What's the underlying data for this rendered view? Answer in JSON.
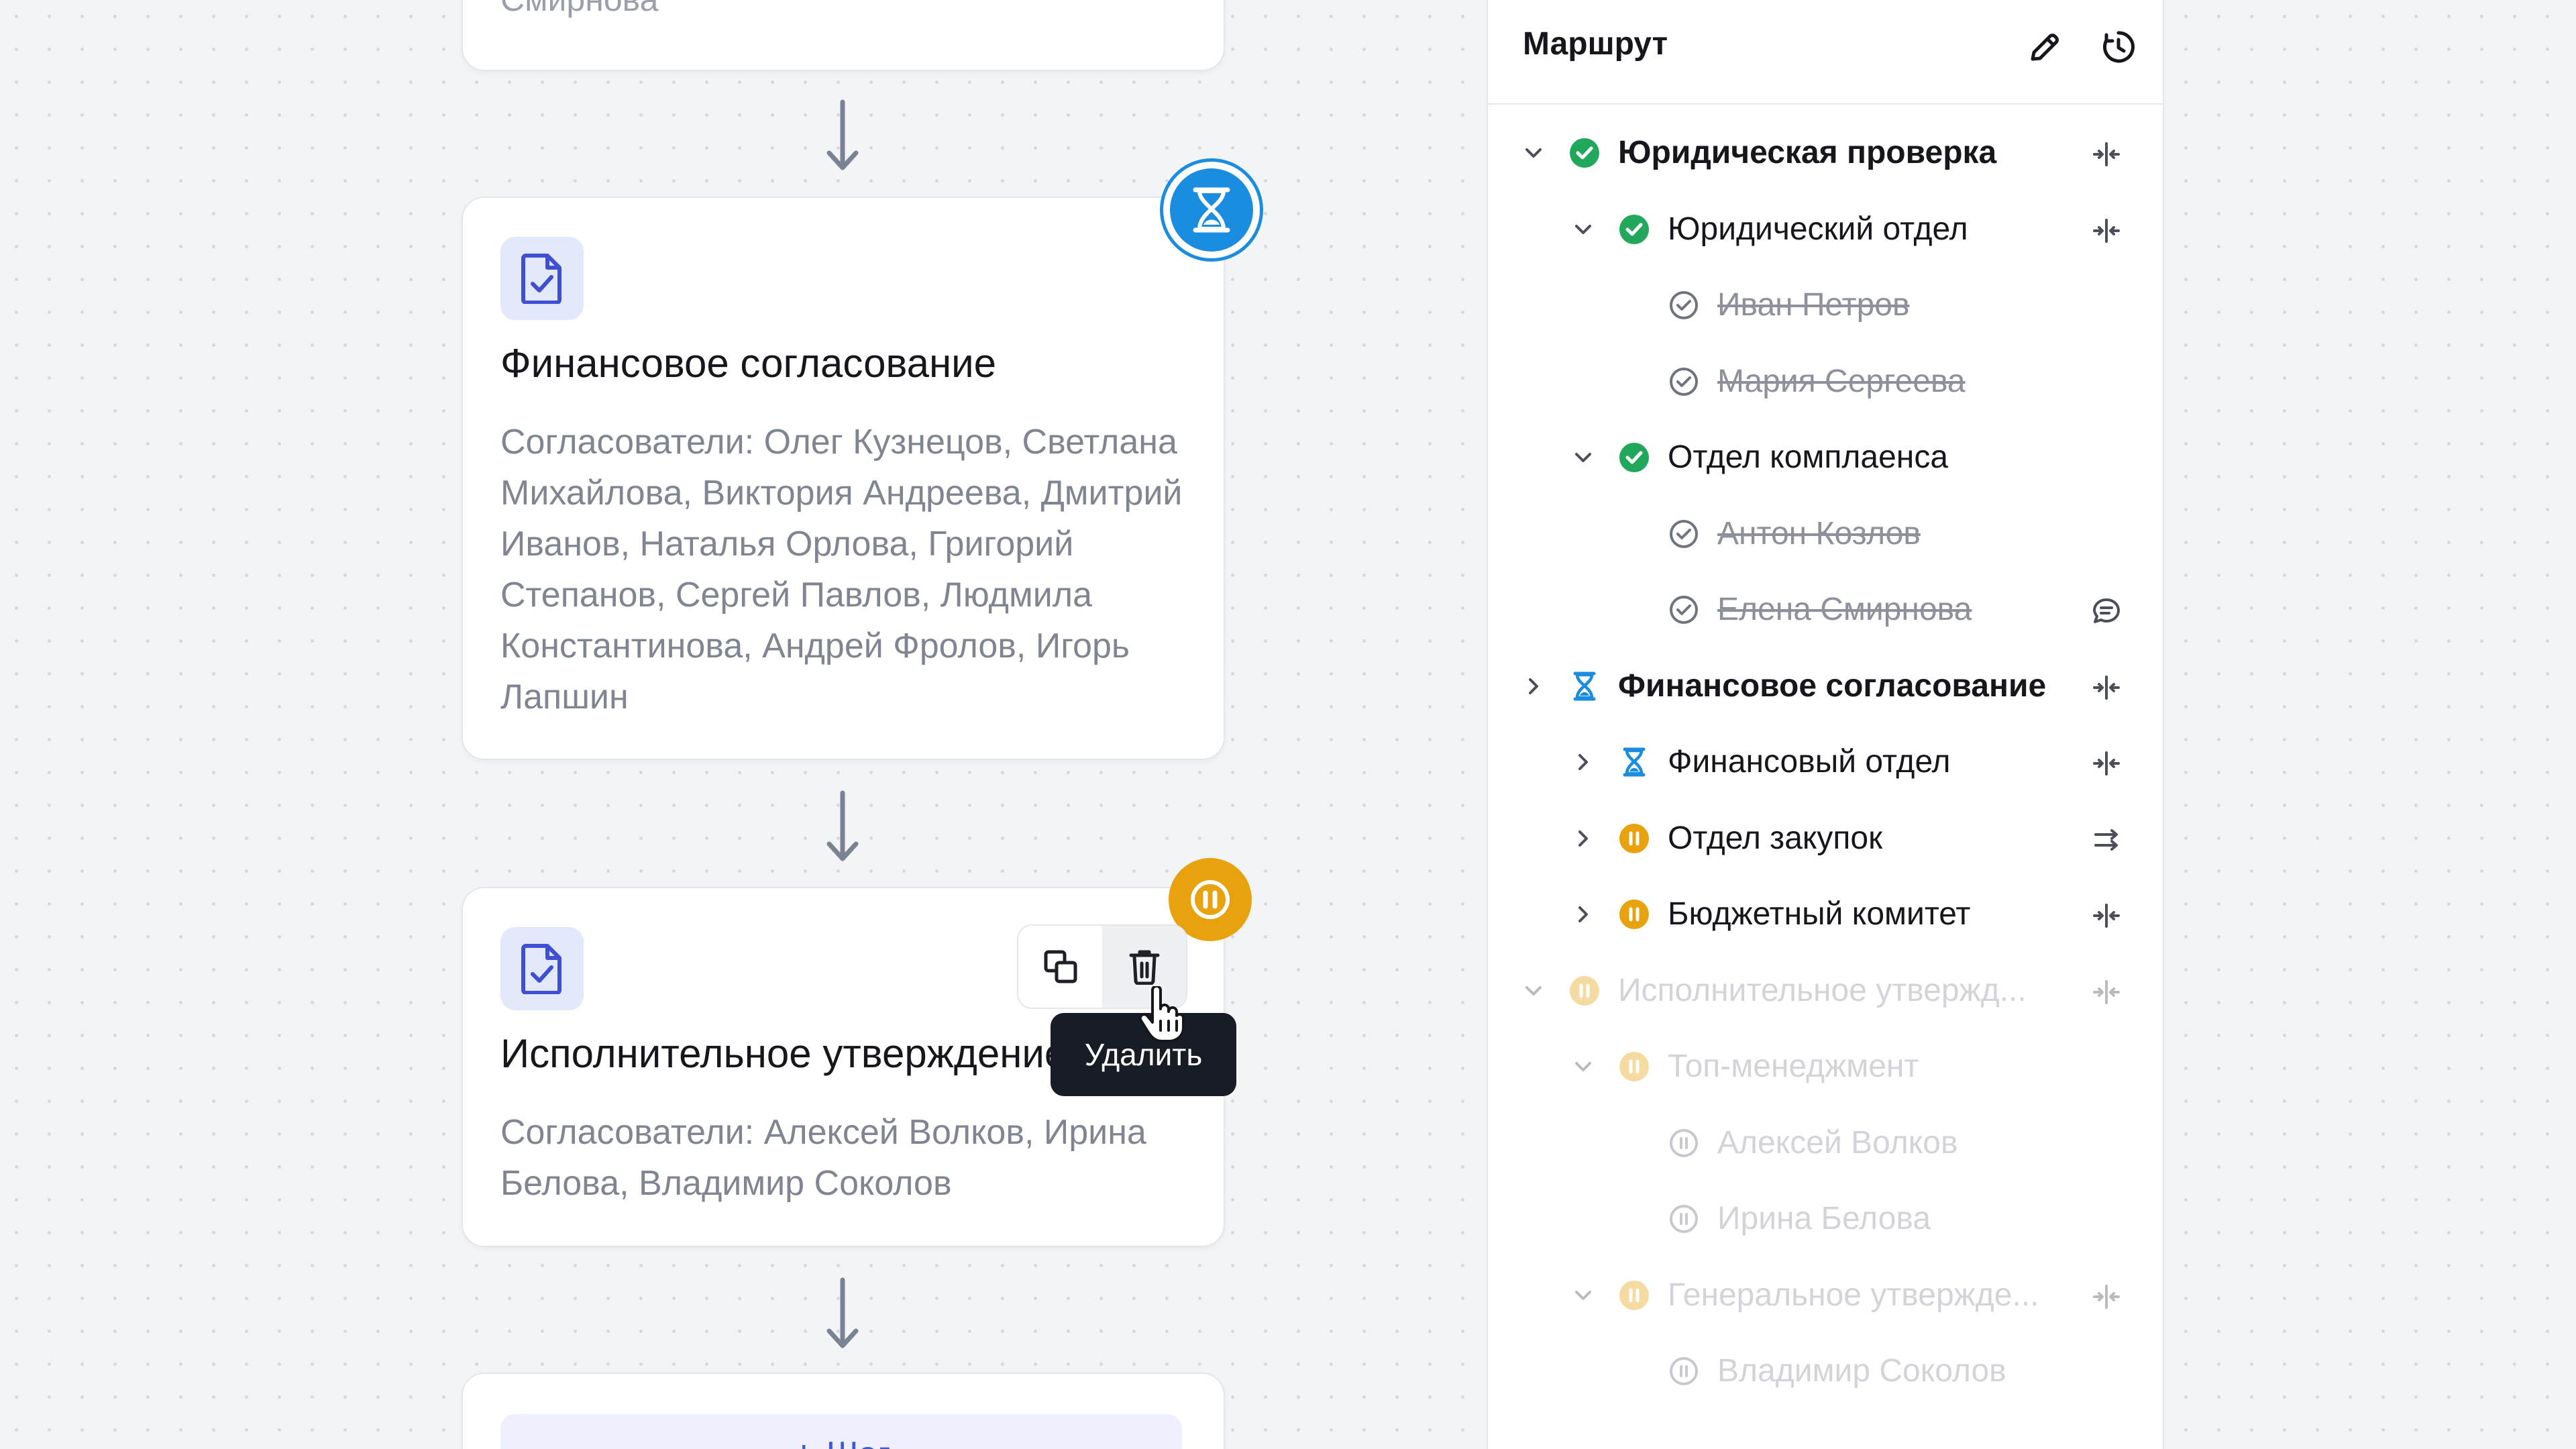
{
  "canvas": {
    "top_card": {
      "tail_text": "Смирнова"
    },
    "finance_card": {
      "title": "Финансовое согласование",
      "description": "Согласователи: Олег Кузнецов, Светлана Михайлова, Виктория Андреева, Дмитрий Иванов, Наталья Орлова, Григорий Степанов, Сергей Павлов, Людмила Константинова, Андрей Фролов, Игорь Лапшин",
      "status_icon": "hourglass-icon"
    },
    "exec_card": {
      "title": "Исполнительное утверждение",
      "description": "Согласователи: Алексей Волков, Ирина Белова, Владимир Соколов",
      "status_icon": "pause-icon",
      "actions": {
        "duplicate_icon": "copy-icon",
        "delete_icon": "trash-icon"
      },
      "tooltip": "Удалить"
    },
    "add_step": {
      "label": "Шаг"
    }
  },
  "panel": {
    "title": "Маршрут",
    "header_icons": [
      "pencil-icon",
      "history-icon"
    ],
    "items": [
      {
        "label": "Юридическая проверка",
        "status": "done",
        "bold": true,
        "chevron": "down",
        "level": 0,
        "action": "split-icon"
      },
      {
        "label": "Юридический отдел",
        "status": "done",
        "bold": false,
        "chevron": "down",
        "level": 1,
        "action": "split-icon"
      },
      {
        "label": "Иван Петров",
        "status": "checked",
        "struck": true,
        "chevron": "",
        "level": 2,
        "action": ""
      },
      {
        "label": "Мария Сергеева",
        "status": "checked",
        "struck": true,
        "chevron": "",
        "level": 2,
        "action": ""
      },
      {
        "label": "Отдел комплаенса",
        "status": "done",
        "bold": false,
        "chevron": "down",
        "level": 1,
        "action": ""
      },
      {
        "label": "Антон Козлов",
        "status": "checked",
        "struck": true,
        "chevron": "",
        "level": 2,
        "action": ""
      },
      {
        "label": "Елена Смирнова",
        "status": "checked",
        "struck": true,
        "chevron": "",
        "level": 2,
        "action": "comment-icon"
      },
      {
        "label": "Финансовое согласование",
        "status": "waiting",
        "bold": true,
        "chevron": "right",
        "level": 0,
        "action": "split-icon"
      },
      {
        "label": "Финансовый отдел",
        "status": "waiting",
        "bold": false,
        "chevron": "right",
        "level": 1,
        "action": "split-icon"
      },
      {
        "label": "Отдел закупок",
        "status": "paused",
        "bold": false,
        "chevron": "right",
        "level": 1,
        "action": "sequence-icon"
      },
      {
        "label": "Бюджетный комитет",
        "status": "paused",
        "bold": false,
        "chevron": "right",
        "level": 1,
        "action": "split-icon"
      },
      {
        "label": "Исполнительное утвержд...",
        "status": "paused",
        "bold": false,
        "chevron": "down",
        "level": 0,
        "action": "split-icon",
        "faded": true
      },
      {
        "label": "Топ-менеджмент",
        "status": "paused",
        "bold": false,
        "chevron": "down",
        "level": 1,
        "action": "",
        "faded": true
      },
      {
        "label": "Алексей Волков",
        "status": "paused-outline",
        "bold": false,
        "chevron": "",
        "level": 2,
        "action": "",
        "faded": true
      },
      {
        "label": "Ирина Белова",
        "status": "paused-outline",
        "bold": false,
        "chevron": "",
        "level": 2,
        "action": "",
        "faded": true
      },
      {
        "label": "Генеральное утвержде...",
        "status": "paused",
        "bold": false,
        "chevron": "down",
        "level": 1,
        "action": "split-icon",
        "faded": true
      },
      {
        "label": "Владимир Соколов",
        "status": "paused-outline",
        "bold": false,
        "chevron": "",
        "level": 2,
        "action": "",
        "faded": true
      }
    ]
  },
  "colors": {
    "done": "#22a85b",
    "waiting": "#1b8de0",
    "paused": "#e7a20d",
    "accent": "#4358d6",
    "muted": "#8c919c"
  }
}
